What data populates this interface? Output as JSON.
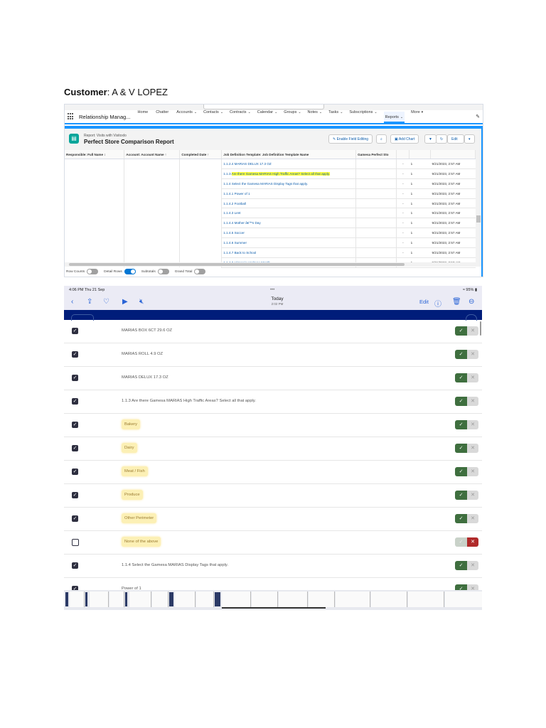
{
  "customer": {
    "label": "Customer",
    "value": ": A & V LOPEZ"
  },
  "salesforce": {
    "app_name": "Relationship Manag...",
    "nav": [
      {
        "label": "Home",
        "chev": ""
      },
      {
        "label": "Chatter",
        "chev": ""
      },
      {
        "label": "Accounts",
        "chev": "⌄"
      },
      {
        "label": "Contacts",
        "chev": "⌄"
      },
      {
        "label": "Contracts",
        "chev": "⌄"
      },
      {
        "label": "Calendar",
        "chev": "⌄"
      },
      {
        "label": "Groups",
        "chev": "⌄"
      },
      {
        "label": "Notes",
        "chev": "⌄"
      },
      {
        "label": "Tasks",
        "chev": "⌄"
      },
      {
        "label": "Subscriptions",
        "chev": "⌄"
      },
      {
        "label": "Reports",
        "chev": "⌄"
      },
      {
        "label": "More",
        "chev": "▾"
      }
    ],
    "report_subtitle": "Report: Visits with Visitoxlo",
    "report_title": "Perfect Store Comparison Report",
    "buttons": {
      "enable_editing": "✎ Enable Field Editing",
      "search": "⌕",
      "add_chart": "Add Chart",
      "filter": "▼",
      "refresh": "↻",
      "edit": "Edit",
      "menu": "▾"
    },
    "columns": [
      "Responsible: Full Name ↕",
      "Account: Account Name ↑",
      "Completed Date ↑",
      "Job Definition Template: Job Definition Template Name",
      "Gamesa Perfect Sto",
      "",
      "",
      ""
    ],
    "rows": [
      {
        "job": "1.1.2.4 MARIAS DELUX 17.3 OZ",
        "dash": "-",
        "count": "1",
        "date": "9/21/2023, 2:57 AM"
      },
      {
        "job_prefix": "1.1.3 ",
        "job_hl": "Are there Gamesa MARIAS High Traffic Areas? Select all that apply.",
        "dash": "-",
        "count": "1",
        "date": "9/21/2023, 2:57 AM"
      },
      {
        "job": "1.1.4 Select the Gamesa MARIAS Display Tags that apply.",
        "dash": "-",
        "count": "1",
        "date": "9/21/2023, 2:57 AM"
      },
      {
        "job": "1.1.4.1 Power of 1",
        "dash": "-",
        "count": "1",
        "date": "9/21/2023, 2:57 AM"
      },
      {
        "job": "1.1.4.2 Football",
        "dash": "-",
        "count": "1",
        "date": "9/21/2023, 2:57 AM"
      },
      {
        "job": "1.1.4.3 Lent",
        "dash": "-",
        "count": "1",
        "date": "9/21/2023, 2:57 AM"
      },
      {
        "job": "1.1.4.4 Mother â€™s Day",
        "dash": "-",
        "count": "1",
        "date": "9/21/2023, 2:57 AM"
      },
      {
        "job": "1.1.4.5 Soccer",
        "dash": "-",
        "count": "1",
        "date": "9/21/2023, 2:57 AM"
      },
      {
        "job": "1.1.4.6 Summer",
        "dash": "-",
        "count": "1",
        "date": "9/21/2023, 2:57 AM"
      },
      {
        "job": "1.1.4.7 Back to School",
        "dash": "-",
        "count": "1",
        "date": "9/21/2023, 2:57 AM"
      },
      {
        "job": "1.1.4.8 Hispanic Heritage Month",
        "dash": "-",
        "count": "1",
        "date": "9/21/2023, 2:57 AM"
      }
    ],
    "footer": [
      {
        "label": "Row Counts",
        "on": false
      },
      {
        "label": "Detail Rows",
        "on": true
      },
      {
        "label": "Subtotals",
        "on": false
      },
      {
        "label": "Grand Total",
        "on": false
      }
    ]
  },
  "ipad": {
    "time": "4:06 PM  Thu 21 Sep",
    "status_dots": "•••",
    "battery": "≈ 95% ▮",
    "title": "Today",
    "subtitle": "2:02 PM",
    "edit": "Edit",
    "items": [
      {
        "label": "MARIAS BOX 6CT 29.6 OZ",
        "checked": true,
        "yes": true,
        "highlight": false
      },
      {
        "label": "MARIAS ROLL 4.9 OZ",
        "checked": true,
        "yes": true,
        "highlight": false
      },
      {
        "label": "MARIAS DELUX 17.3 OZ",
        "checked": true,
        "yes": true,
        "highlight": false
      },
      {
        "label": "1.1.3 Are there Gamesa MARIAS High Traffic Areas? Select all that apply.",
        "checked": true,
        "yes": true,
        "highlight": false
      },
      {
        "label": "Bakery",
        "checked": true,
        "yes": true,
        "highlight": true
      },
      {
        "label": "Dairy",
        "checked": true,
        "yes": true,
        "highlight": true
      },
      {
        "label": "Meat / Fish",
        "checked": true,
        "yes": true,
        "highlight": true
      },
      {
        "label": "Produce",
        "checked": true,
        "yes": true,
        "highlight": true
      },
      {
        "label": "Other Perimeter",
        "checked": true,
        "yes": true,
        "highlight": true
      },
      {
        "label": "None of the above",
        "checked": false,
        "yes": false,
        "highlight": true
      },
      {
        "label": "1.1.4 Select the Gamesa MARIAS Display Tags that apply.",
        "checked": true,
        "yes": true,
        "highlight": false
      },
      {
        "label": "Power of 1",
        "checked": true,
        "yes": true,
        "highlight": false
      }
    ]
  },
  "colors": {
    "salesforce_blue": "#1b96ff",
    "ipad_band": "#001d7a",
    "yes_green": "#3f6f3f",
    "no_red": "#b02a2a",
    "highlight": "#ffff3a"
  }
}
